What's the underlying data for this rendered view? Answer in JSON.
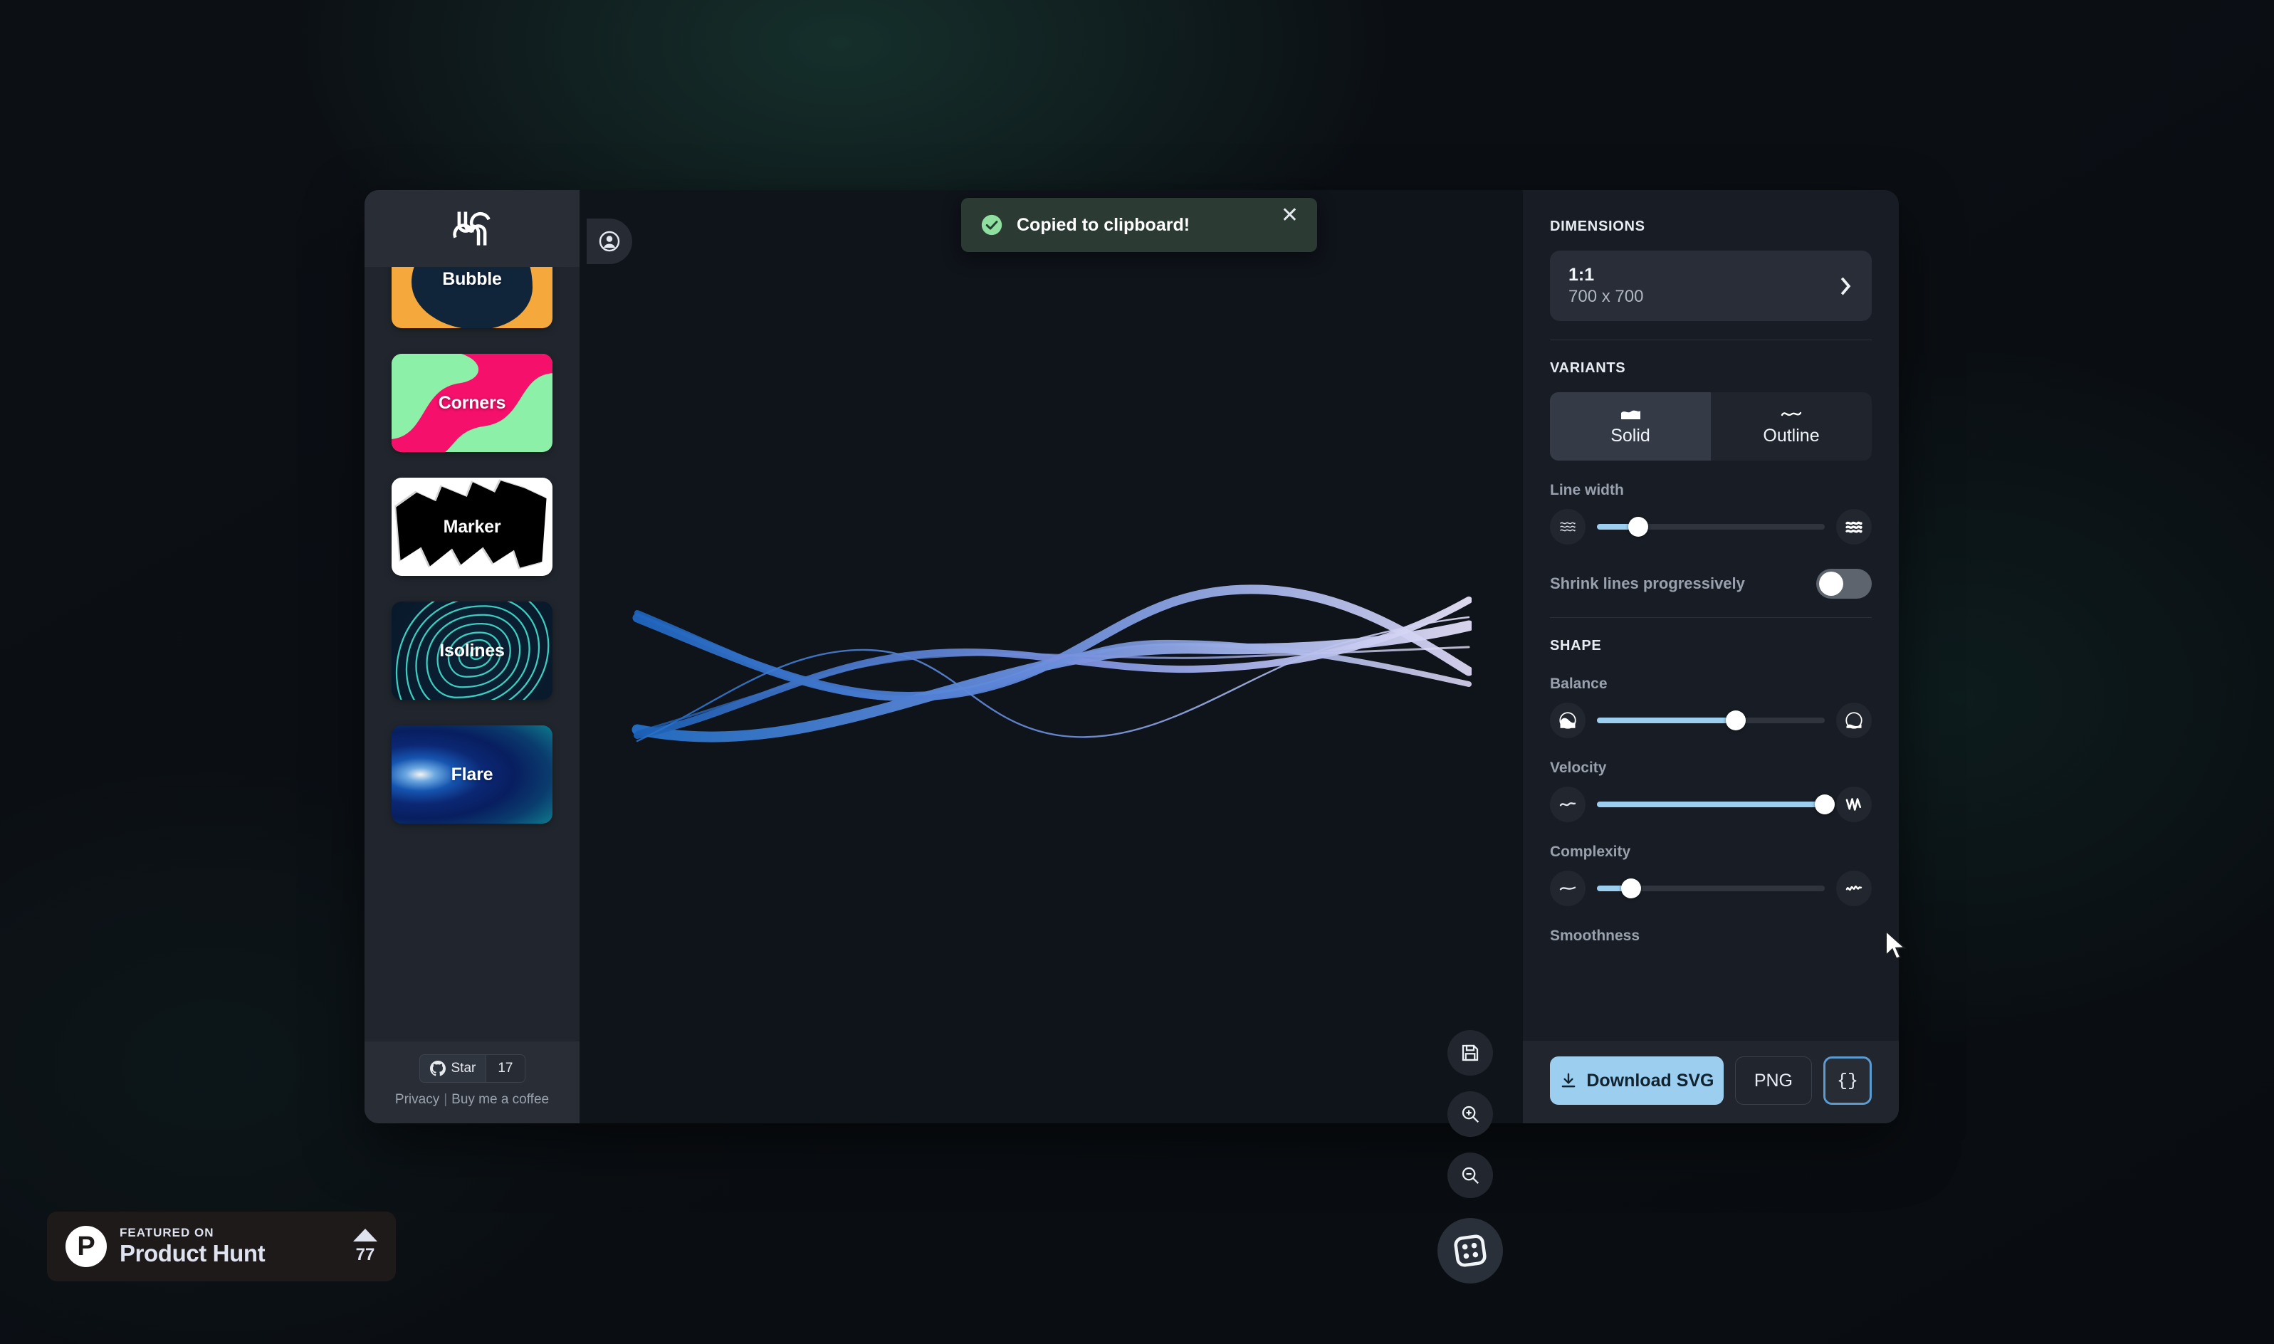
{
  "app": {
    "logo_icon": "squiggle-logo-icon"
  },
  "sidebar": {
    "presets": [
      {
        "label": "Bubble",
        "icon": "bubble-thumbnail"
      },
      {
        "label": "Corners",
        "icon": "corners-thumbnail"
      },
      {
        "label": "Marker",
        "icon": "marker-thumbnail"
      },
      {
        "label": "Isolines",
        "icon": "isolines-thumbnail"
      },
      {
        "label": "Flare",
        "icon": "flare-thumbnail"
      }
    ],
    "github": {
      "icon": "github-icon",
      "label": "Star",
      "count": "17"
    },
    "footer": {
      "privacy": "Privacy",
      "separator": "|",
      "coffee": "Buy me a coffee"
    }
  },
  "canvas": {
    "account_icon": "user-circle-icon",
    "tools": [
      {
        "icon": "save-icon",
        "name": "save-button"
      },
      {
        "icon": "zoom-in-icon",
        "name": "zoom-in-button"
      },
      {
        "icon": "zoom-out-icon",
        "name": "zoom-out-button"
      }
    ],
    "randomize_icon": "dice-icon"
  },
  "toast": {
    "icon": "check-circle-icon",
    "message": "Copied to clipboard!",
    "close_icon": "close-icon",
    "close_glyph": "✕",
    "bg": "#2b3a33",
    "accent": "#8fe0a0"
  },
  "panel": {
    "dimensions": {
      "title": "DIMENSIONS",
      "ratio": "1:1",
      "size": "700 x 700",
      "chevron_icon": "chevron-right-icon",
      "chevron_glyph": "›"
    },
    "variants": {
      "title": "VARIANTS",
      "options": [
        {
          "label": "Solid",
          "icon": "solid-wave-icon",
          "active": true
        },
        {
          "label": "Outline",
          "icon": "outline-wave-icon",
          "active": false
        }
      ]
    },
    "line_width": {
      "label": "Line width",
      "value_pct": 18,
      "min_icon": "thin-lines-icon",
      "max_icon": "thick-lines-icon"
    },
    "shrink": {
      "label": "Shrink lines progressively",
      "enabled": false
    },
    "shape": {
      "title": "SHAPE",
      "sliders": [
        {
          "label": "Balance",
          "value_pct": 61,
          "min_icon": "balance-low-icon",
          "max_icon": "balance-high-icon"
        },
        {
          "label": "Velocity",
          "value_pct": 100,
          "min_icon": "velocity-low-icon",
          "max_icon": "velocity-high-icon"
        },
        {
          "label": "Complexity",
          "value_pct": 15,
          "min_icon": "complexity-low-icon",
          "max_icon": "complexity-high-icon"
        }
      ],
      "smoothness_label": "Smoothness"
    },
    "actions": {
      "download_svg": "Download SVG",
      "download_icon": "download-icon",
      "png": "PNG",
      "code": "{}",
      "code_icon": "curly-braces-icon"
    },
    "accent": "#9ccef0"
  },
  "product_hunt": {
    "logo_letter": "P",
    "kicker": "FEATURED ON",
    "name": "Product Hunt",
    "upvote_icon": "triangle-up-icon",
    "count": "77"
  }
}
